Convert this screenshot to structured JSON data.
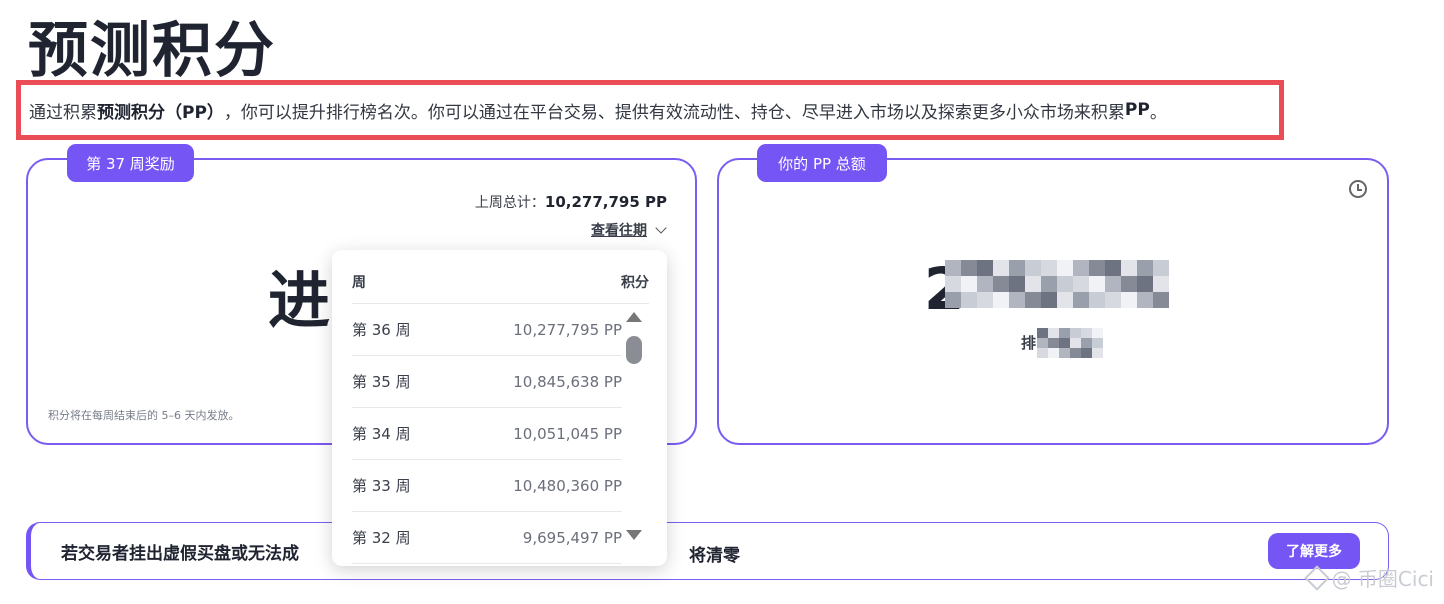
{
  "page": {
    "title": "预测积分",
    "intro_pre": "通过积累",
    "intro_bold": "预测积分（PP）",
    "intro_mid": "，你可以提升排行榜名次。你可以通过在平台交易、提供有效流动性、持仓、尽早进入市场以及探索更多小众市场来积累",
    "intro_bold2": "PP",
    "intro_end": "。"
  },
  "weekly_card": {
    "tag": "第 37 周奖励",
    "last_week_label": "上周总计：",
    "last_week_value": "10,277,795 PP",
    "history_link": "查看往期",
    "status": "进",
    "note": "积分将在每周结束后的 5–6 天内发放。"
  },
  "total_card": {
    "tag": "你的 PP 总额",
    "total_visible": "2",
    "rank_label": "排"
  },
  "history_dropdown": {
    "col_week": "周",
    "col_points": "积分",
    "rows": [
      {
        "week": "第 36 周",
        "points": "10,277,795 PP"
      },
      {
        "week": "第 35 周",
        "points": "10,845,638 PP"
      },
      {
        "week": "第 34 周",
        "points": "10,051,045 PP"
      },
      {
        "week": "第 33 周",
        "points": "10,480,360 PP"
      },
      {
        "week": "第 32 周",
        "points": "9,695,497 PP"
      }
    ]
  },
  "banner": {
    "text": "若交易者挂出虚假买盘或无法成",
    "text_tail": "将清零",
    "button": "了解更多"
  },
  "watermark": {
    "text": "@ 币圈Cici"
  },
  "colors": {
    "accent": "#7655f5",
    "highlight": "#ea4d55",
    "text": "#1f2430"
  }
}
